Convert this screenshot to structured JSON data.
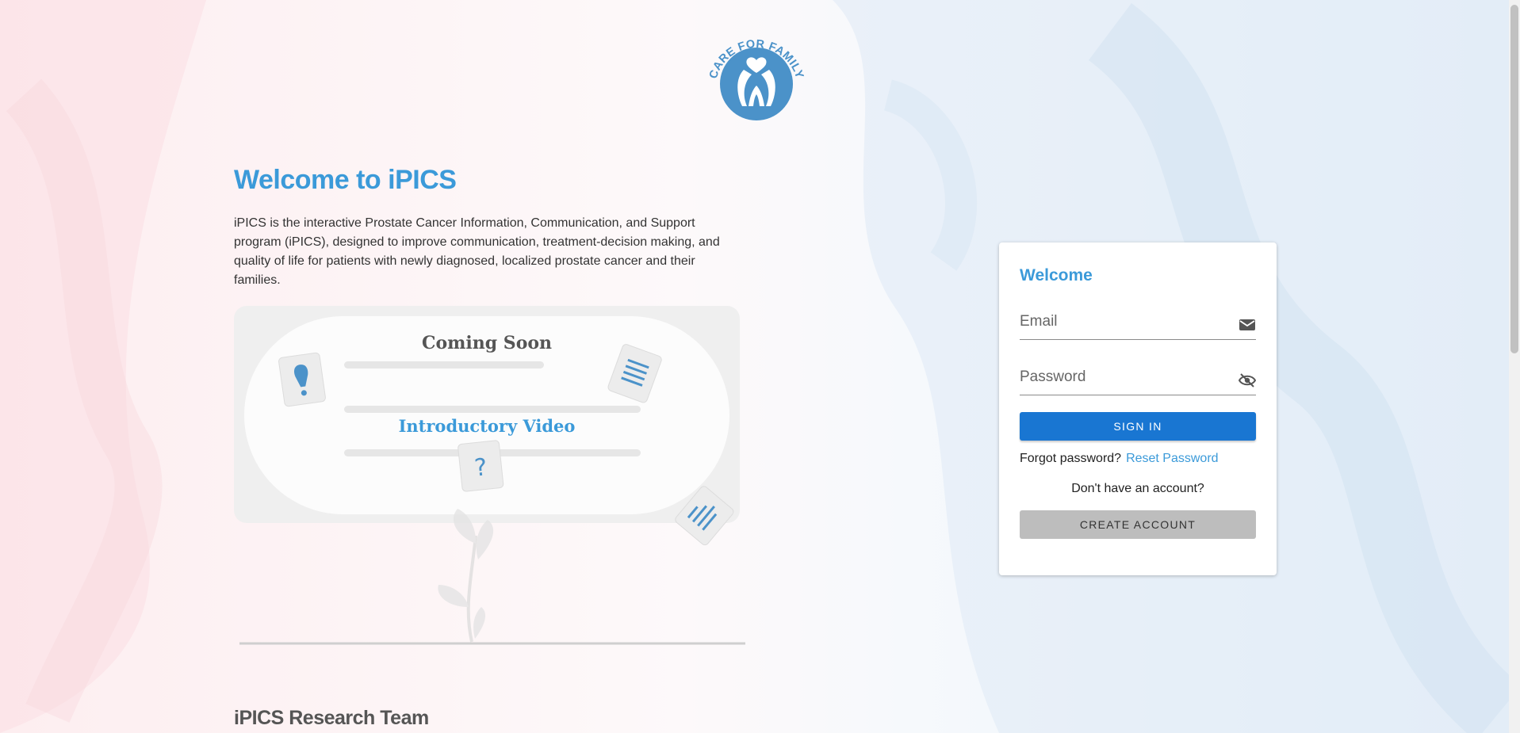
{
  "brand": {
    "logo_text": "CARE FOR FAMILY",
    "colors": {
      "primary": "#3b9ad9",
      "button": "#1976d2",
      "logo": "#4b92c9"
    }
  },
  "intro": {
    "title": "Welcome to iPICS",
    "description": "iPICS is the interactive Prostate Cancer Information, Communication, and Support program (iPICS), designed to improve communication, treatment-decision making, and quality of life for patients with newly diagnosed, localized prostate cancer and their families."
  },
  "video": {
    "coming_soon": "Coming Soon",
    "label": "Introductory Video"
  },
  "team": {
    "heading": "iPICS Research Team"
  },
  "login": {
    "heading": "Welcome",
    "email_placeholder": "Email",
    "email_icon": "mail-icon",
    "password_placeholder": "Password",
    "password_icon": "visibility-off-icon",
    "sign_in": "SIGN IN",
    "forgot_text": "Forgot password?",
    "reset_link": "Reset Password",
    "no_account": "Don't have an account?",
    "create_account": "CREATE ACCOUNT"
  }
}
